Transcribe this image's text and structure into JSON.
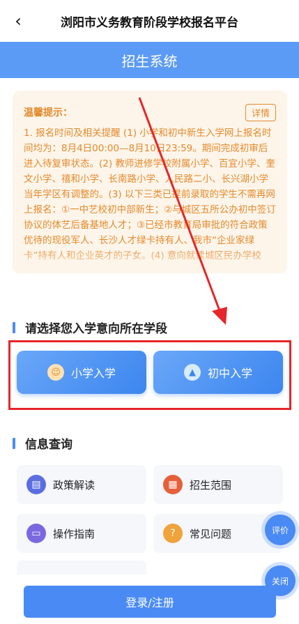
{
  "header": {
    "back_icon": "chevron-left-icon",
    "title": "浏阳市义务教育阶段学校报名平台"
  },
  "banner": {
    "title": "招生系统"
  },
  "notice": {
    "label": "温馨提示：",
    "detail_label": "详情",
    "text": "1. 报名时间及相关提醒 (1) 小学和初中新生入学网上报名时间均为：8月4日00:00—8月10日23:59。期间完成初审后进入待复审状态。(2) 教师进修学校附属小学、百宜小学、奎文小学、禧和小学、长南路小学、人民路二小、长兴湖小学当年学区有调整的。(3) 以下三类已提前录取的学生不需再网上报名：①一中艺校初中部新生；②与城区五所公办初中签订协议的体艺后备基地人才；③已经市教育局审批的符合政策优待的现役军人、长沙人才绿卡持有人、我市“企业家绿卡”持有人和企业英才的子女。(4) 意向就读城区民办学校"
  },
  "stage": {
    "title": "请选择您入学意向所在学段",
    "primary_label": "小学入学",
    "middle_label": "初中入学"
  },
  "info": {
    "title": "信息查询",
    "items": [
      {
        "label": "政策解读",
        "icon": "policy-icon",
        "color": "#5b6ee0"
      },
      {
        "label": "招生范围",
        "icon": "building-icon",
        "color": "#e5603a"
      },
      {
        "label": "操作指南",
        "icon": "monitor-icon",
        "color": "#7b67e0"
      },
      {
        "label": "常见问题",
        "icon": "question-icon",
        "color": "#f0a33a"
      }
    ]
  },
  "floating": {
    "rate_label": "评价",
    "close_label": "关闭"
  },
  "login": {
    "label": "登录/注册"
  },
  "colors": {
    "accent": "#4a8af4",
    "notice_text": "#e48a2d",
    "highlight": "#e5262a"
  }
}
